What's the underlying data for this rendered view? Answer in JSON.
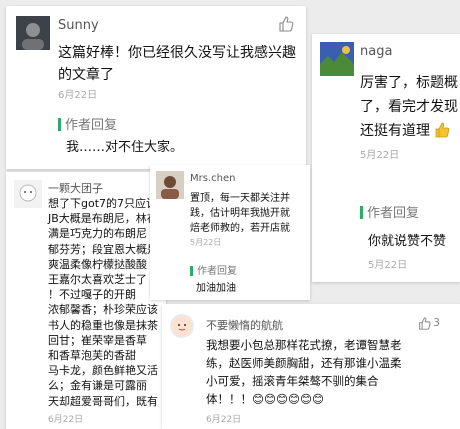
{
  "cards": [
    {
      "name": "Sunny",
      "lines": [
        "这篇好棒！你已经很久没写让我感兴趣",
        "的文章了"
      ],
      "date": "6月22日",
      "reply_label": "作者回复",
      "reply_text": "我……对不住大家。"
    },
    {
      "name": "naga",
      "lines": [
        "厉害了，标题概",
        "了，看完才发现",
        "还挺有道理"
      ],
      "date": "5月22日",
      "reply_label": "作者回复",
      "reply_text": "你就说赞不赞",
      "reply_date": "5月22日"
    },
    {
      "name": "一颗大团子",
      "lines": [
        "想了下got7的7只应该",
        "JB大概是布朗尼，林在",
        "满是巧克力的布朗尼",
        "郁芬芳；段宜恩大概是",
        "爽温柔像柠檬挞酸酸",
        "王嘉尔太喜欢芝士了",
        "！不过嘎子的开朗",
        "浓郁馨香；朴珍荣应该",
        "书人的稳重也像是抹茶",
        "回甘；崔荣宰是香草",
        "和香草泡芙的香甜",
        "马卡龙，颜色鲜艳又活",
        "么；金有谦是可露丽",
        "天却超爱哥哥们，既有"
      ],
      "date": "6月22日"
    },
    {
      "name": "Mrs.chen",
      "lines": [
        "置顶，每一天都关注并",
        "践，估计明年我抛开就",
        "焙老师教的，若开店就"
      ],
      "date": "5月22日",
      "reply_label": "作者回复",
      "reply_text": "加油加油"
    },
    {
      "name": "不要懒惰的航航",
      "likes": "3",
      "lines": [
        "我想要小包总那样花式撩，老谭智慧老",
        "练，赵医师美颜胸甜，还有那谁小温柔",
        "小可爱，摇滚青年桀骜不驯的集合",
        "体！！！😊😊😊😊😊😊"
      ],
      "date": "6月22日"
    }
  ],
  "icons": {
    "like": "thumbs-up-icon",
    "liked": "thumbs-up-emoji"
  },
  "colors": {
    "accent": "#2aae67",
    "background": "#ececec"
  }
}
